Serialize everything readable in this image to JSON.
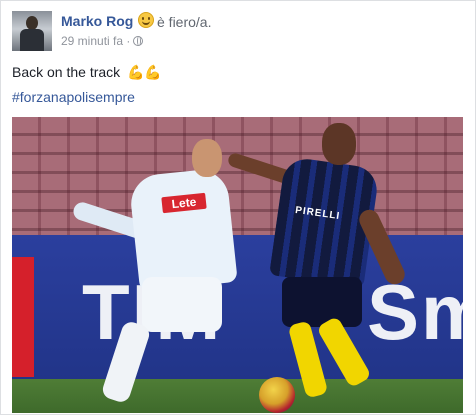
{
  "post": {
    "author": "Marko Rog",
    "feeling": "è fiero/a.",
    "time": "29 minuti fa",
    "time_separator": "·",
    "text": "Back on the track",
    "emoji": "💪💪",
    "hashtag": "#forzanapolisempre"
  },
  "photo": {
    "banner_left": "TIM",
    "banner_right": "Sm",
    "shirt_sponsor": "Lete",
    "inter_sponsor": "PIRELLI"
  },
  "colors": {
    "link": "#365899",
    "text": "#1d2129",
    "meta": "#90949c"
  }
}
